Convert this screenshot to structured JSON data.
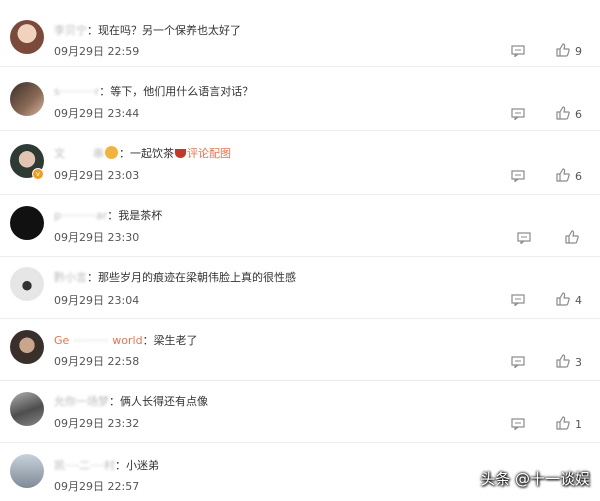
{
  "comments": [
    {
      "user": "李贝宁",
      "text": "现在吗？另一个保养也太好了",
      "time": "09月29日 22:59",
      "likes": "9",
      "avatar_color": "#d7a88e"
    },
    {
      "user": "s··········r",
      "text": "等下，他们用什么语言对话？",
      "time": "09月29日 23:44",
      "likes": "6",
      "avatar_color": "#6a5a52"
    },
    {
      "user": "文",
      "user_tail": "串",
      "text_a": "一起饮茶",
      "text_b": "评论配图",
      "time": "09月29日 23:03",
      "likes": "6",
      "avatar_color": "#3c4a44"
    },
    {
      "user": "p··········ar",
      "text": "我是茶杯",
      "time": "09月29日 23:30",
      "likes": "",
      "avatar_color": "#111111"
    },
    {
      "user": "黔小言",
      "text": "那些岁月的痕迹在梁朝伟脸上真的很性感",
      "time": "09月29日 23:04",
      "likes": "4",
      "avatar_color": "#cfcfcf"
    },
    {
      "user": "Ge",
      "user_tail": "world",
      "text": "梁生老了",
      "time": "09月29日 22:58",
      "likes": "3",
      "avatar_color": "#4a3f3a"
    },
    {
      "user": "允你一场梦",
      "text": "俩人长得还有点像",
      "time": "09月29日 23:32",
      "likes": "1",
      "avatar_color": "#7a7a7a"
    },
    {
      "user": "凯····二····村",
      "text": "小迷弟",
      "time": "09月29日 22:57",
      "likes": "",
      "avatar_color": "#9aa6b3"
    }
  ],
  "watermark": "头条 @十一谈娱",
  "colors": {
    "username": "#eb7350",
    "icon": "#8a8a8a"
  }
}
